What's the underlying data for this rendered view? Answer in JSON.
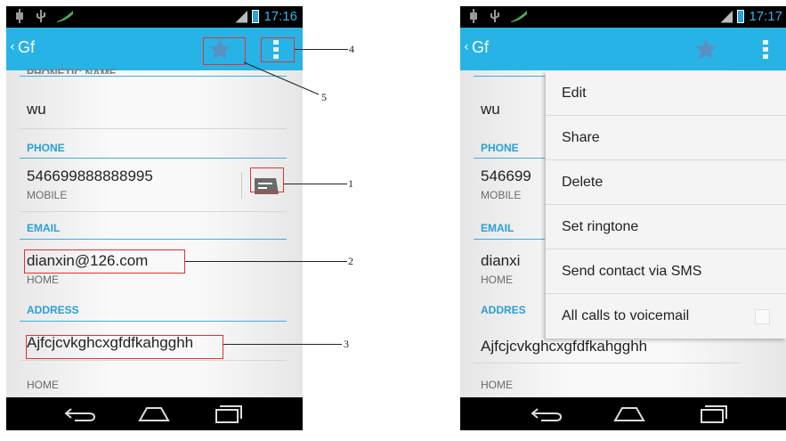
{
  "left_screen": {
    "status_time": "17:16",
    "title": "Gf",
    "cut_header": "PHONETIC NAME",
    "phonetic_value": "wu",
    "phone_section": "PHONE",
    "phone_number": "546699888888995",
    "phone_type": "MOBILE",
    "email_section": "EMAIL",
    "email_value": "dianxin@126.com",
    "email_type": "HOME",
    "address_section": "ADDRESS",
    "address_value": "Ajfcjcvkghcxgfdfkahgghh",
    "address_type": "HOME"
  },
  "annotations": [
    "1",
    "2",
    "3",
    "4",
    "5"
  ],
  "right_screen": {
    "status_time": "17:17",
    "title": "Gf",
    "phonetic_value": "wu",
    "phone_section": "PHONE",
    "phone_number_partial": "546699",
    "phone_type_partial": "MOBILE",
    "email_section": "EMAIL",
    "email_partial": "dianxi",
    "email_type": "HOME",
    "address_section_partial": "ADDRES",
    "address_value": "Ajfcjcvkghcxgfdfkahgghh",
    "address_type": "HOME",
    "menu": [
      "Edit",
      "Share",
      "Delete",
      "Set ringtone",
      "Send contact via SMS",
      "All calls to voicemail"
    ]
  },
  "colors": {
    "actionbar": "#28b3e6",
    "section": "#2a9fd8",
    "annotation": "#e53030"
  },
  "icons": [
    "usb-icon",
    "android-icon",
    "signal-icon",
    "battery-icon",
    "star-icon",
    "overflow-menu-icon",
    "message-icon",
    "back-icon",
    "home-icon",
    "recents-icon"
  ]
}
